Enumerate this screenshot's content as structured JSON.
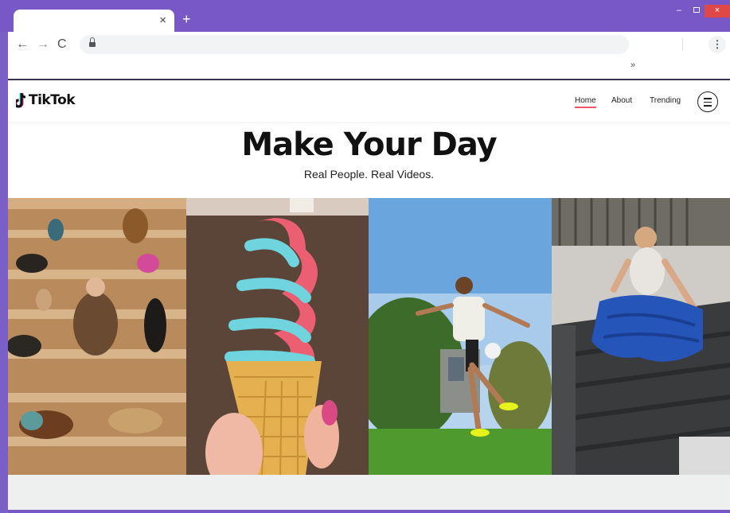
{
  "browser": {
    "tab_close": "×",
    "new_tab": "+",
    "window_min": "–",
    "window_close": "×",
    "back": "←",
    "forward": "→",
    "reload": "C",
    "menu": "⋮",
    "bookmarks_chevron": "»"
  },
  "site": {
    "logo_text": "TikTok",
    "nav": {
      "home": "Home",
      "about": "About",
      "trending": "Trending"
    },
    "hero_title": "Make Your Day",
    "hero_subtitle": "Real People. Real Videos."
  },
  "colors": {
    "window_frame": "#7758c6",
    "nav_underline": "#f5536b",
    "tiktok_cyan": "#25f4ee",
    "tiktok_red": "#fe2c55"
  },
  "photos": [
    {
      "icon": "dogs-on-steps-photo"
    },
    {
      "icon": "ice-cream-cone-photo"
    },
    {
      "icon": "soccer-juggling-photo"
    },
    {
      "icon": "tarp-truck-photo"
    }
  ]
}
